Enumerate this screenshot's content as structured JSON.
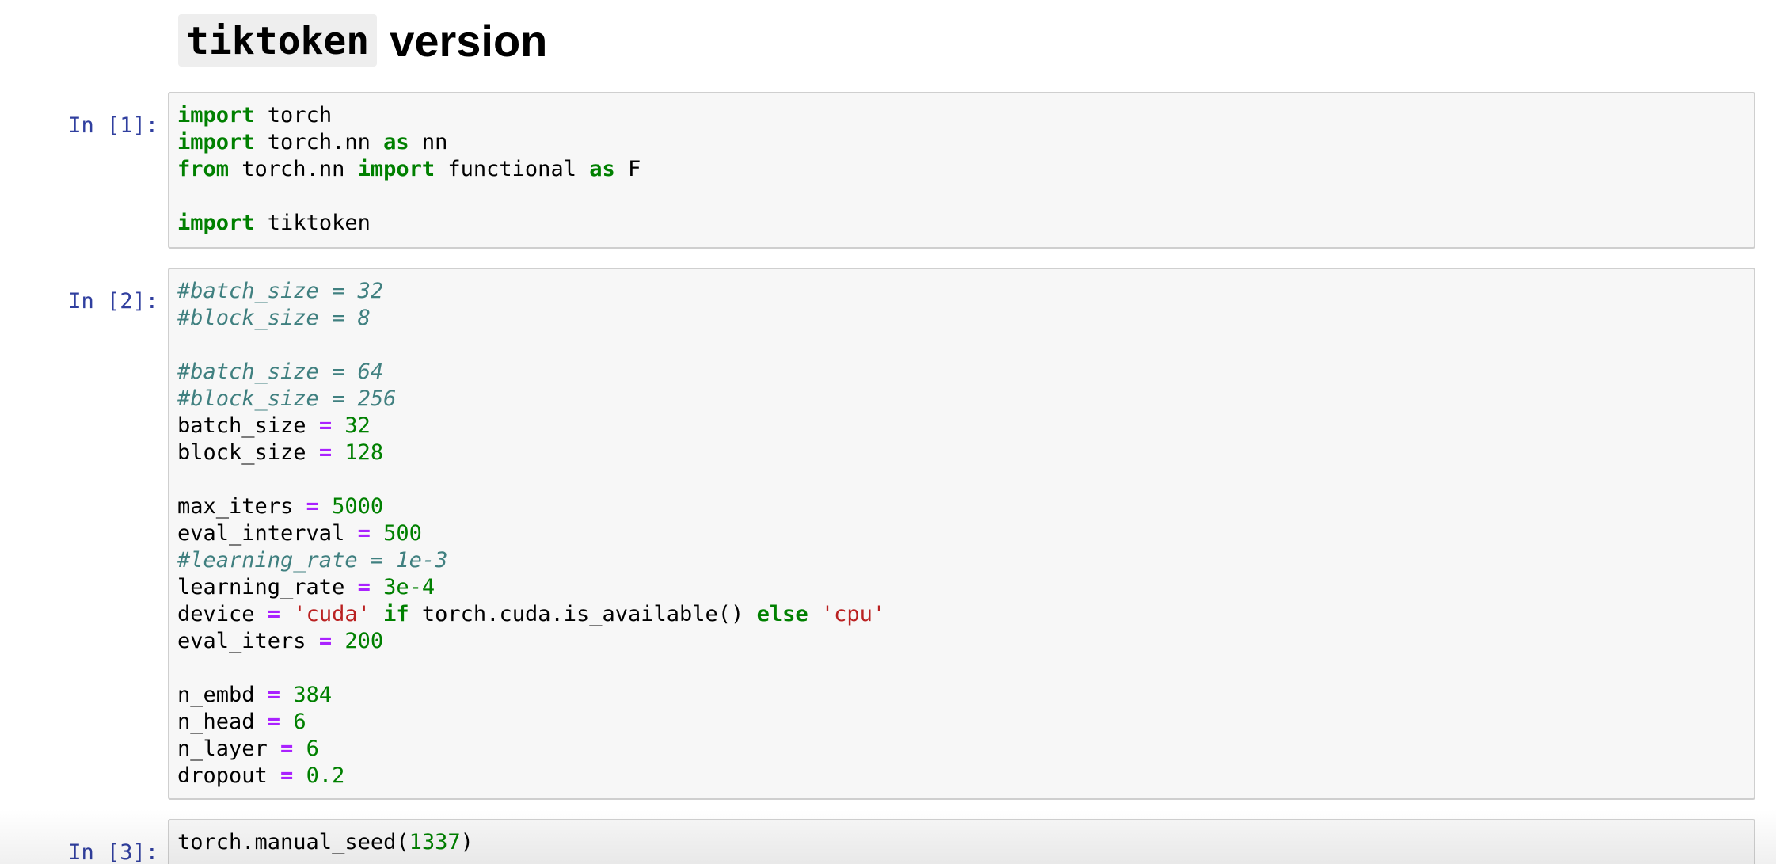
{
  "heading": {
    "code": "tiktoken",
    "text": "version"
  },
  "cells": [
    {
      "prompt": "In [1]:",
      "lines": [
        [
          {
            "t": "import",
            "c": "kw"
          },
          {
            "t": " torch"
          }
        ],
        [
          {
            "t": "import",
            "c": "kw"
          },
          {
            "t": " torch.nn "
          },
          {
            "t": "as",
            "c": "kw"
          },
          {
            "t": " nn"
          }
        ],
        [
          {
            "t": "from",
            "c": "kw"
          },
          {
            "t": " torch.nn "
          },
          {
            "t": "import",
            "c": "kw"
          },
          {
            "t": " functional "
          },
          {
            "t": "as",
            "c": "kw"
          },
          {
            "t": " F"
          }
        ],
        [],
        [
          {
            "t": "import",
            "c": "kw"
          },
          {
            "t": " tiktoken"
          }
        ]
      ]
    },
    {
      "prompt": "In [2]:",
      "lines": [
        [
          {
            "t": "#batch_size = 32",
            "c": "cm"
          }
        ],
        [
          {
            "t": "#block_size = 8",
            "c": "cm"
          }
        ],
        [],
        [
          {
            "t": "#batch_size = 64",
            "c": "cm"
          }
        ],
        [
          {
            "t": "#block_size = 256",
            "c": "cm"
          }
        ],
        [
          {
            "t": "batch_size "
          },
          {
            "t": "=",
            "c": "op"
          },
          {
            "t": " "
          },
          {
            "t": "32",
            "c": "num"
          }
        ],
        [
          {
            "t": "block_size "
          },
          {
            "t": "=",
            "c": "op"
          },
          {
            "t": " "
          },
          {
            "t": "128",
            "c": "num"
          }
        ],
        [],
        [
          {
            "t": "max_iters "
          },
          {
            "t": "=",
            "c": "op"
          },
          {
            "t": " "
          },
          {
            "t": "5000",
            "c": "num"
          }
        ],
        [
          {
            "t": "eval_interval "
          },
          {
            "t": "=",
            "c": "op"
          },
          {
            "t": " "
          },
          {
            "t": "500",
            "c": "num"
          }
        ],
        [
          {
            "t": "#learning_rate = 1e-3",
            "c": "cm"
          }
        ],
        [
          {
            "t": "learning_rate "
          },
          {
            "t": "=",
            "c": "op"
          },
          {
            "t": " "
          },
          {
            "t": "3e-4",
            "c": "num"
          }
        ],
        [
          {
            "t": "device "
          },
          {
            "t": "=",
            "c": "op"
          },
          {
            "t": " "
          },
          {
            "t": "'cuda'",
            "c": "str"
          },
          {
            "t": " "
          },
          {
            "t": "if",
            "c": "kw"
          },
          {
            "t": " torch.cuda.is_available() "
          },
          {
            "t": "else",
            "c": "kw"
          },
          {
            "t": " "
          },
          {
            "t": "'cpu'",
            "c": "str"
          }
        ],
        [
          {
            "t": "eval_iters "
          },
          {
            "t": "=",
            "c": "op"
          },
          {
            "t": " "
          },
          {
            "t": "200",
            "c": "num"
          }
        ],
        [],
        [
          {
            "t": "n_embd "
          },
          {
            "t": "=",
            "c": "op"
          },
          {
            "t": " "
          },
          {
            "t": "384",
            "c": "num"
          }
        ],
        [
          {
            "t": "n_head "
          },
          {
            "t": "=",
            "c": "op"
          },
          {
            "t": " "
          },
          {
            "t": "6",
            "c": "num"
          }
        ],
        [
          {
            "t": "n_layer "
          },
          {
            "t": "=",
            "c": "op"
          },
          {
            "t": " "
          },
          {
            "t": "6",
            "c": "num"
          }
        ],
        [
          {
            "t": "dropout "
          },
          {
            "t": "=",
            "c": "op"
          },
          {
            "t": " "
          },
          {
            "t": "0.2",
            "c": "num"
          }
        ]
      ]
    },
    {
      "prompt": "In [3]:",
      "lines": [
        [
          {
            "t": "torch.manual_seed("
          },
          {
            "t": "1337",
            "c": "num"
          },
          {
            "t": ")"
          }
        ]
      ]
    }
  ]
}
